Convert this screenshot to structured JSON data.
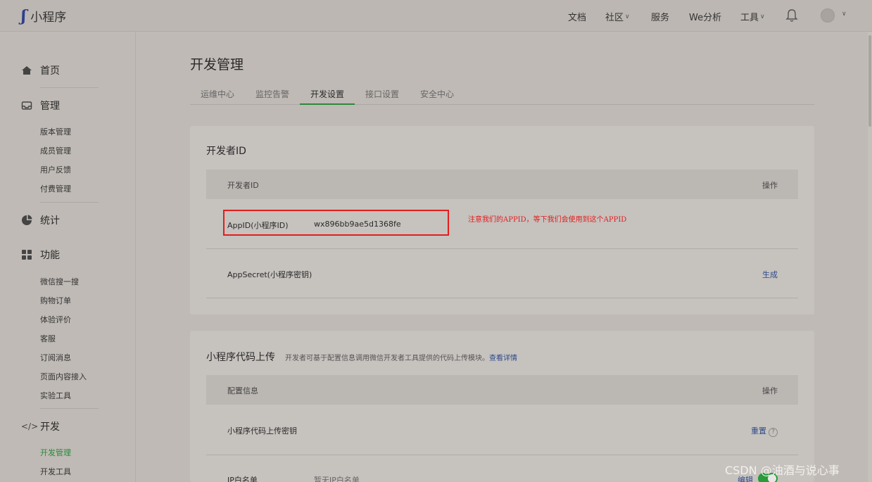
{
  "header": {
    "logo_text": "小程序",
    "nav": {
      "docs": "文档",
      "community": "社区",
      "services": "服务",
      "we_analysis": "We分析",
      "tools": "工具"
    }
  },
  "sidebar": {
    "home": "首页",
    "manage": {
      "label": "管理",
      "items": [
        "版本管理",
        "成员管理",
        "用户反馈",
        "付费管理"
      ]
    },
    "stats": "统计",
    "features": {
      "label": "功能",
      "items": [
        "微信搜一搜",
        "购物订单",
        "体验评价",
        "客服",
        "订阅消息",
        "页面内容接入",
        "实验工具"
      ]
    },
    "dev": {
      "label": "开发",
      "items": [
        "开发管理",
        "开发工具"
      ]
    }
  },
  "main": {
    "title": "开发管理",
    "tabs": [
      "运维中心",
      "监控告警",
      "开发设置",
      "接口设置",
      "安全中心"
    ],
    "active_tab": "开发设置",
    "developer_id": {
      "title": "开发者ID",
      "col_left": "开发者ID",
      "col_right": "操作",
      "appid_label": "AppID(小程序ID)",
      "appid_value": "wx896bb9ae5d1368fe",
      "appsecret_label": "AppSecret(小程序密钥)",
      "appsecret_action": "生成"
    },
    "annotation": "注意我们的APPID，等下我们会使用到这个APPID",
    "code_upload": {
      "title": "小程序代码上传",
      "desc": "开发者可基于配置信息调用微信开发者工具提供的代码上传模块。",
      "desc_link": "查看详情",
      "col_left": "配置信息",
      "col_right": "操作",
      "key_label": "小程序代码上传密钥",
      "key_action": "重置",
      "ip_label": "IP白名单",
      "ip_value": "暂无IP白名单",
      "ip_action": "编辑"
    }
  },
  "watermark": "CSDN @油酒与说心事",
  "colors": {
    "accent": "#2a8a3a",
    "annotation": "#e31d1d",
    "link": "#2e4a8a"
  }
}
